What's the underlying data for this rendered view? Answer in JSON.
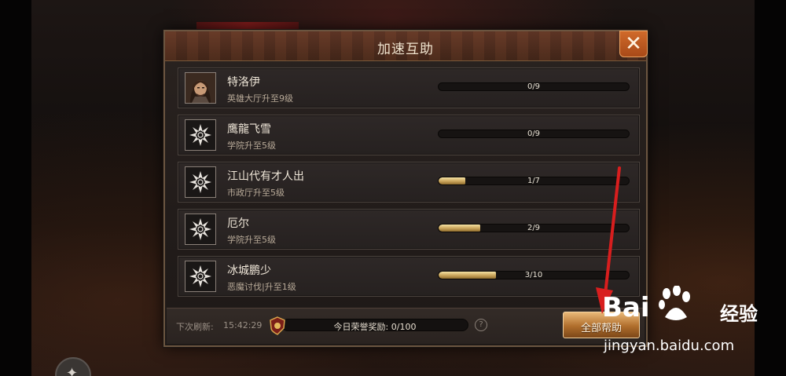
{
  "dialog": {
    "title": "加速互助",
    "close_icon": "close-icon"
  },
  "rows": [
    {
      "name": "特洛伊",
      "task": "英雄大厅升至9级",
      "progress_text": "0/9",
      "progress_fraction": 0.0,
      "avatar": "hero-portrait"
    },
    {
      "name": "鹰龍飞雪",
      "task": "学院升至5级",
      "progress_text": "0/9",
      "progress_fraction": 0.0,
      "avatar": "default-emblem-icon"
    },
    {
      "name": "江山代有才人出",
      "task": "市政厅升至5级",
      "progress_text": "1/7",
      "progress_fraction": 0.14,
      "avatar": "default-emblem-icon"
    },
    {
      "name": "厄尔",
      "task": "学院升至5级",
      "progress_text": "2/9",
      "progress_fraction": 0.22,
      "avatar": "default-emblem-icon"
    },
    {
      "name": "冰城鹏少",
      "task": "恶魔讨伐|升至1级",
      "progress_text": "3/10",
      "progress_fraction": 0.3,
      "avatar": "default-emblem-icon"
    }
  ],
  "footer": {
    "refresh_label": "下次刷新:",
    "refresh_time": "15:42:29",
    "honor_reward": "今日荣誉奖励: 0/100",
    "help_icon": "?",
    "all_help_button": "全部帮助"
  },
  "watermark": {
    "brand": "Bai",
    "brand_suffix": "经验",
    "url": "jingyan.baidu.com"
  },
  "colors": {
    "accent_gold": "#c9a45a",
    "close_orange": "#d06a2a",
    "annotation_red": "#d81e1e"
  }
}
